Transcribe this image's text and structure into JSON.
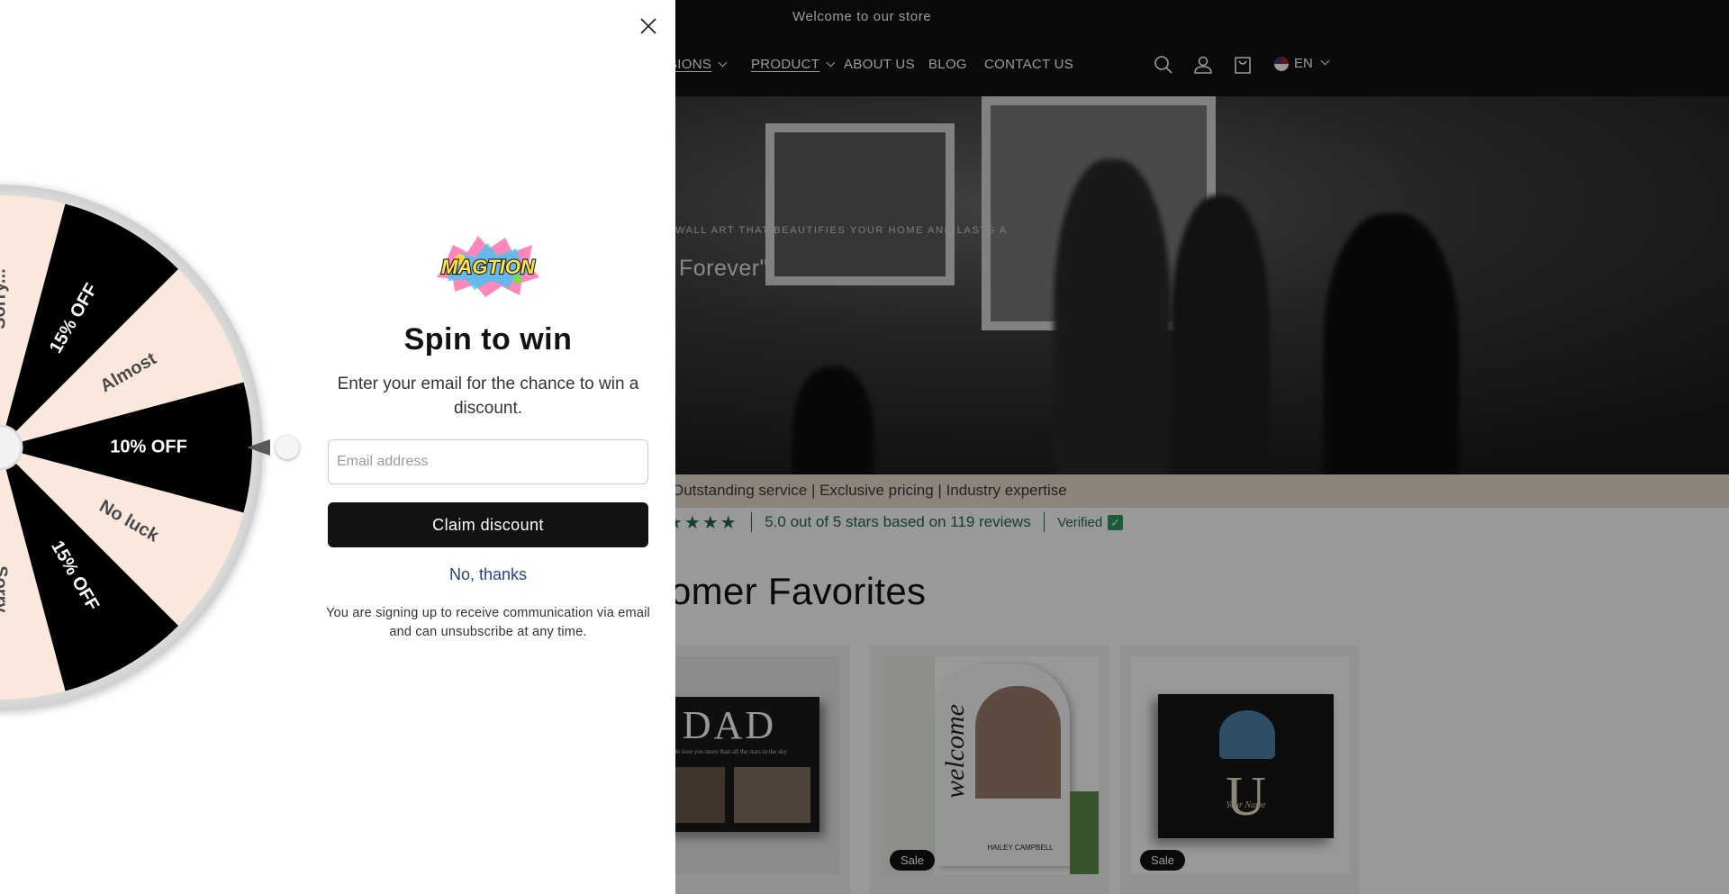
{
  "store": {
    "announcement": "Welcome to our store",
    "nav": {
      "occasions_label": "SIONS",
      "product_label": "PRODUCT",
      "about_label": "ABOUT US",
      "blog_label": "BLOG",
      "contact_label": "CONTACT US"
    },
    "language": "EN",
    "hero": {
      "eyebrow": "WALL ART THAT BEAUTIFIES YOUR HOME AND LASTS A",
      "title": "Forever\""
    },
    "trust_text": "Outstanding service | Exclusive pricing | Industry expertise",
    "reviews": {
      "stars": "★★★★",
      "summary": "5.0 out of 5 stars based on 119 reviews",
      "verified": "Verified"
    },
    "section_title": "omer Favorites",
    "products": [
      {
        "badge": "",
        "art_word": "DAD",
        "art_caption": "We love you more than all the stars in the sky"
      },
      {
        "badge": "Sale",
        "art_word": "welcome",
        "art_caption": "HAILEY CAMPBELL"
      },
      {
        "badge": "Sale",
        "art_word": "I U",
        "art_caption": "Your Name"
      }
    ]
  },
  "popup": {
    "logo_text": "MAGTION",
    "title": "Spin to win",
    "subtitle": "Enter your email for the chance to win a discount.",
    "email_placeholder": "Email address",
    "claim_label": "Claim discount",
    "no_thanks_label": "No, thanks",
    "disclaimer": "You are signing up to receive communication via email and can unsubscribe at any time.",
    "wheel": {
      "segments": [
        {
          "label": "10% OFF",
          "color": "#000000",
          "text_color": "#ffffff"
        },
        {
          "label": "No luck",
          "color": "#fbe8dd",
          "text_color": "#4a4a4a"
        },
        {
          "label": "15% OFF",
          "color": "#000000",
          "text_color": "#ffffff"
        },
        {
          "label": "Sorry...",
          "color": "#fbe8dd",
          "text_color": "#4a4a4a"
        },
        {
          "label": "",
          "color": "#000000",
          "text_color": "#ffffff"
        },
        {
          "label": "",
          "color": "#fbe8dd",
          "text_color": "#4a4a4a"
        },
        {
          "label": "",
          "color": "#000000",
          "text_color": "#ffffff"
        },
        {
          "label": "",
          "color": "#fbe8dd",
          "text_color": "#4a4a4a"
        },
        {
          "label": "",
          "color": "#000000",
          "text_color": "#ffffff"
        },
        {
          "label": "Sorry...",
          "color": "#fbe8dd",
          "text_color": "#4a4a4a"
        },
        {
          "label": "15% OFF",
          "color": "#000000",
          "text_color": "#ffffff"
        },
        {
          "label": "Almost",
          "color": "#fbe8dd",
          "text_color": "#4a4a4a"
        }
      ]
    }
  }
}
